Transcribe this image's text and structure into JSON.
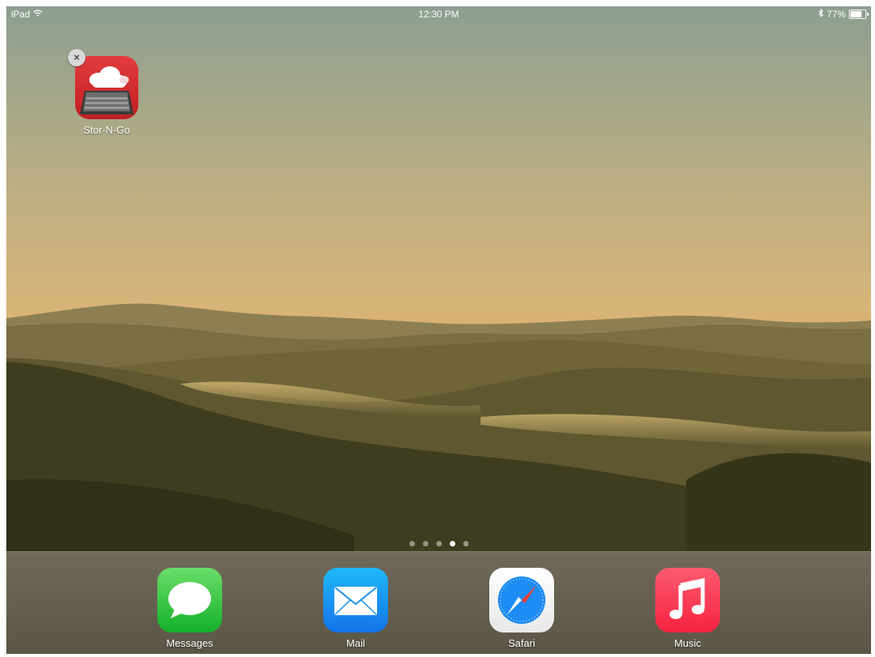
{
  "status_bar": {
    "device": "iPad",
    "time": "12:30 PM",
    "battery_text": "77%",
    "battery_level": 0.77,
    "icons": [
      "wifi-icon",
      "bluetooth-icon",
      "battery-icon"
    ]
  },
  "home_screen": {
    "apps": [
      {
        "label": "Stor-N-Go",
        "icon": "stor-n-go-icon",
        "editing": true
      }
    ],
    "page_indicator": {
      "pages": 5,
      "current": 4
    }
  },
  "dock": {
    "apps": [
      {
        "label": "Messages",
        "icon": "messages-icon"
      },
      {
        "label": "Mail",
        "icon": "mail-icon"
      },
      {
        "label": "Safari",
        "icon": "safari-icon"
      },
      {
        "label": "Music",
        "icon": "music-icon"
      }
    ]
  },
  "colors": {
    "stor_icon": "#d2292c",
    "messages_icon": "#2bc33f",
    "mail_icon": "#1a8ff0",
    "music_icon": "#f8354f",
    "active_dot": "#ffffff"
  }
}
